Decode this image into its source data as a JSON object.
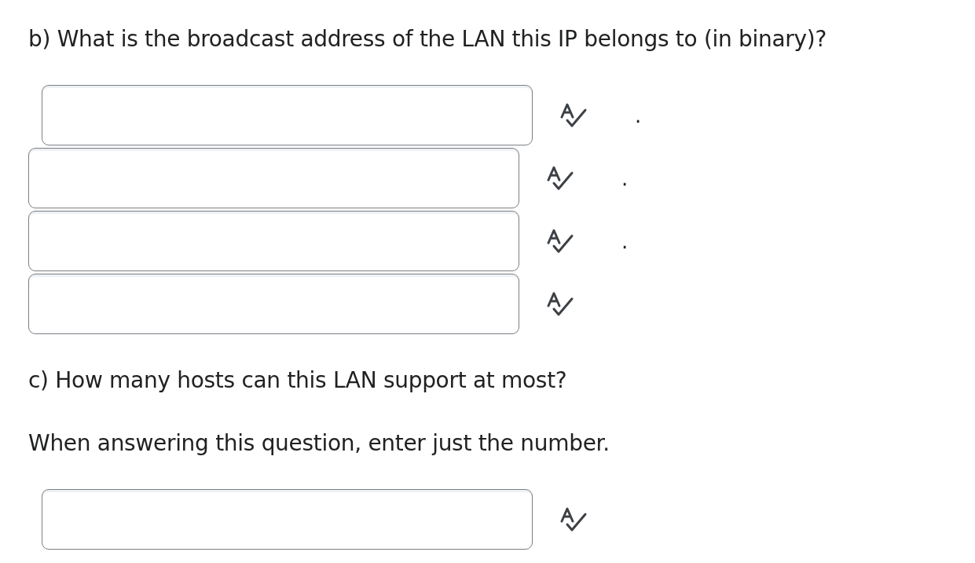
{
  "question_b": {
    "prompt": "b) What is the broadcast address of the LAN this IP belongs to (in binary)?",
    "fields": [
      {
        "kind": "text",
        "separator": "."
      },
      {
        "kind": "text",
        "separator": "."
      },
      {
        "kind": "text",
        "separator": "."
      },
      {
        "kind": "text"
      }
    ]
  },
  "question_c": {
    "prompt": "c) How many hosts can this LAN support at most?",
    "instruction": "When answering this question, enter just the number.",
    "fields": [
      {
        "kind": "text"
      }
    ]
  }
}
